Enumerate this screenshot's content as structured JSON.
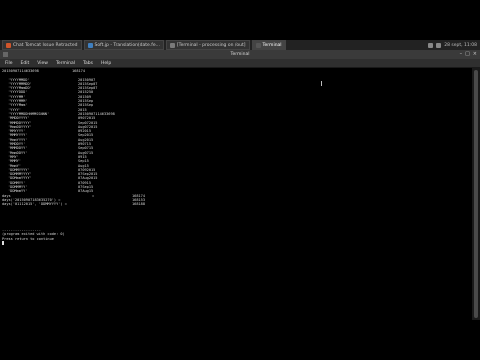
{
  "taskbar": {
    "tasks": [
      {
        "label": "Chat Tomcat Issue Retracted",
        "color": "#d0552b"
      },
      {
        "label": "Soft.jp - Translation(date.fe...",
        "color": "#3f7fbf"
      },
      {
        "label": "[Terminal - processing on /out]",
        "color": "#7a7a7a"
      },
      {
        "label": "Terminal",
        "color": "#555555"
      }
    ],
    "tray_text": "28 sept, 11:08"
  },
  "window": {
    "title": "Terminal",
    "menu": [
      "File",
      "Edit",
      "View",
      "Terminal",
      "Tabs",
      "Help"
    ]
  },
  "terminal": {
    "header": {
      "c0": "20150907114633698",
      "c1": "168174"
    },
    "format_rows": [
      {
        "c0": "'YYYYMMDD'",
        "c1": "20150907"
      },
      {
        "c0": "'YYYYMMMDD'",
        "c1": "2015Sep07"
      },
      {
        "c0": "'YYYYMmmDD'",
        "c1": "2015Sep07"
      },
      {
        "c0": "'YYYYDDD'",
        "c1": "2015250"
      },
      {
        "c0": "'YYYYMM'",
        "c1": "201509"
      },
      {
        "c0": "'YYYYMMM'",
        "c1": "2015Sep"
      },
      {
        "c0": "'YYYYMmm'",
        "c1": "2015Sep"
      },
      {
        "c0": "'YYYY'",
        "c1": "2015"
      },
      {
        "c0": "'YYYYMMDDHHMMSSNNN'",
        "c1": "20150907114633698"
      },
      {
        "c0": "'MMDDYYYY'",
        "c1": "09072015"
      },
      {
        "c0": "'MMMDDYYYY'",
        "c1": "Sep072015"
      },
      {
        "c0": "'MmmDDYYYY'",
        "c1": "Aug072015"
      },
      {
        "c0": "'MMYYYY'",
        "c1": "092015"
      },
      {
        "c0": "'MMMYYYY'",
        "c1": "Sep2015"
      },
      {
        "c0": "'MmmYYYY'",
        "c1": "Aug2015"
      },
      {
        "c0": "'MMDDYY'",
        "c1": "090715"
      },
      {
        "c0": "'MMMDDYY'",
        "c1": "Sep0715"
      },
      {
        "c0": "'MmmDDYY'",
        "c1": "Aug0715"
      },
      {
        "c0": "'MMY'",
        "c1": "0915"
      },
      {
        "c0": "'MMMY'",
        "c1": "Sep15"
      },
      {
        "c0": "'MmmY'",
        "c1": "Aug15"
      },
      {
        "c0": "'DDMMYYYY'",
        "c1": "07092015"
      },
      {
        "c0": "'DDMMMYYYY'",
        "c1": "07Sep2015"
      },
      {
        "c0": "'DDMmmYYYY'",
        "c1": "07Aug2015"
      },
      {
        "c0": "'DDMMYY'",
        "c1": "070915"
      },
      {
        "c0": "'DDMMMYY'",
        "c1": "07Sep15"
      },
      {
        "c0": "'DDMmmYY'",
        "c1": "07Aug15"
      }
    ],
    "days_rows": [
      {
        "c0": "days",
        "c1": "=",
        "c2": "168174"
      },
      {
        "c0": "days('20150907183635270') =",
        "c1": "",
        "c2": "168153"
      },
      {
        "c0": "days('01112015', 'DDMMYYYY') =",
        "c1": "",
        "c2": "168188"
      }
    ],
    "separator": "------------------",
    "exit_line": "(program exited with code: 0)",
    "prompt_line": "Press return to continue"
  }
}
